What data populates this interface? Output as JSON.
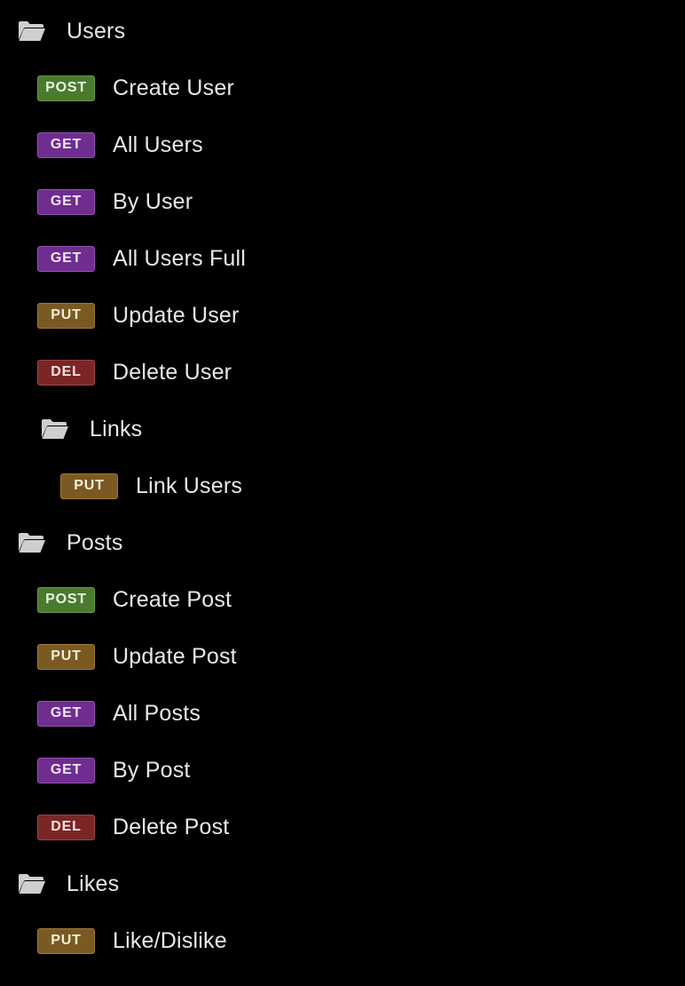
{
  "colors": {
    "background": "#000000",
    "text": "#e8e8e8",
    "POST": {
      "bg": "#4a7a2e",
      "border": "#6b9a49",
      "fg": "#e9f3e2"
    },
    "GET": {
      "bg": "#6f2d8f",
      "border": "#9453b3",
      "fg": "#f1e6f7"
    },
    "PUT": {
      "bg": "#7a5a22",
      "border": "#a17a3a",
      "fg": "#f7ecd6"
    },
    "DEL": {
      "bg": "#7a2626",
      "border": "#a04343",
      "fg": "#f6e1e1"
    }
  },
  "tree": {
    "users": {
      "label": "Users",
      "icon": "folder-open-icon",
      "items": [
        {
          "method": "POST",
          "label": "Create User"
        },
        {
          "method": "GET",
          "label": "All Users"
        },
        {
          "method": "GET",
          "label": "By User"
        },
        {
          "method": "GET",
          "label": "All Users Full"
        },
        {
          "method": "PUT",
          "label": "Update User"
        },
        {
          "method": "DEL",
          "label": "Delete User"
        }
      ],
      "links": {
        "label": "Links",
        "icon": "folder-open-icon",
        "items": [
          {
            "method": "PUT",
            "label": "Link Users"
          }
        ]
      }
    },
    "posts": {
      "label": "Posts",
      "icon": "folder-open-icon",
      "items": [
        {
          "method": "POST",
          "label": "Create Post"
        },
        {
          "method": "PUT",
          "label": "Update Post"
        },
        {
          "method": "GET",
          "label": "All Posts"
        },
        {
          "method": "GET",
          "label": "By Post"
        },
        {
          "method": "DEL",
          "label": "Delete Post"
        }
      ]
    },
    "likes": {
      "label": "Likes",
      "icon": "folder-open-icon",
      "items": [
        {
          "method": "PUT",
          "label": "Like/Dislike"
        }
      ]
    }
  }
}
